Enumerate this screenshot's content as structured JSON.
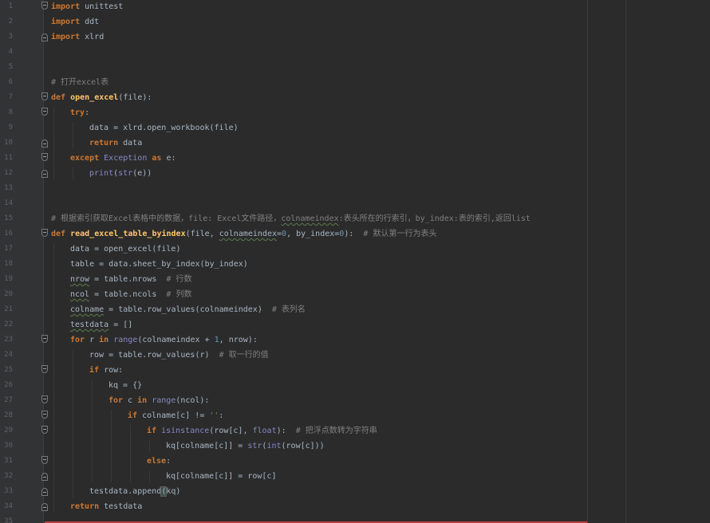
{
  "editor": {
    "language": "python",
    "colors": {
      "background": "#2b2b2b",
      "gutter": "#313335",
      "keyword": "#cc7832",
      "function": "#ffc66d",
      "builtin": "#8888c6",
      "comment": "#808080",
      "number": "#6897bb",
      "string": "#6a8759",
      "text": "#a9b7c6",
      "error_marker": "#bc3f3c"
    },
    "lines": [
      {
        "n": "1",
        "indent": 0,
        "fold": "open",
        "tokens": [
          [
            "kw",
            "import"
          ],
          [
            "t",
            " unittest"
          ]
        ]
      },
      {
        "n": "2",
        "indent": 0,
        "tokens": [
          [
            "kw",
            "import"
          ],
          [
            "t",
            " ddt"
          ]
        ]
      },
      {
        "n": "3",
        "indent": 0,
        "fold": "end",
        "tokens": [
          [
            "kw",
            "import"
          ],
          [
            "t",
            " xlrd"
          ]
        ]
      },
      {
        "n": "4",
        "indent": 0,
        "tokens": []
      },
      {
        "n": "5",
        "indent": 0,
        "tokens": []
      },
      {
        "n": "6",
        "indent": 0,
        "tokens": [
          [
            "cm",
            "# 打开excel表"
          ]
        ]
      },
      {
        "n": "7",
        "indent": 0,
        "fold": "open",
        "tokens": [
          [
            "kw",
            "def "
          ],
          [
            "fn",
            "open_excel"
          ],
          [
            "t",
            "(file):"
          ]
        ]
      },
      {
        "n": "8",
        "indent": 1,
        "fold": "open",
        "tokens": [
          [
            "kw",
            "try"
          ],
          [
            "t",
            ":"
          ]
        ]
      },
      {
        "n": "9",
        "indent": 2,
        "tokens": [
          [
            "t",
            "data = xlrd.open_workbook(file)"
          ]
        ]
      },
      {
        "n": "10",
        "indent": 2,
        "fold": "end",
        "tokens": [
          [
            "kw",
            "return"
          ],
          [
            "t",
            " data"
          ]
        ]
      },
      {
        "n": "11",
        "indent": 1,
        "fold": "open",
        "tokens": [
          [
            "kw",
            "except"
          ],
          [
            "t",
            " "
          ],
          [
            "bi",
            "Exception"
          ],
          [
            "t",
            " "
          ],
          [
            "kw",
            "as"
          ],
          [
            "t",
            " e:"
          ]
        ]
      },
      {
        "n": "12",
        "indent": 2,
        "fold": "end",
        "tokens": [
          [
            "bi",
            "print"
          ],
          [
            "t",
            "("
          ],
          [
            "bi",
            "str"
          ],
          [
            "t",
            "(e))"
          ]
        ]
      },
      {
        "n": "13",
        "indent": 0,
        "tokens": []
      },
      {
        "n": "14",
        "indent": 0,
        "tokens": []
      },
      {
        "n": "15",
        "indent": 0,
        "tokens": [
          [
            "cm",
            "# 根据索引获取Excel表格中的数据，file: Excel文件路径，"
          ],
          [
            "cmul",
            "colnameindex"
          ],
          [
            "cm",
            ":表头所在的行索引，by_index:表的索引,返回list"
          ]
        ]
      },
      {
        "n": "16",
        "indent": 0,
        "fold": "open",
        "tokens": [
          [
            "kw",
            "def "
          ],
          [
            "fn",
            "read_excel_table_byindex"
          ],
          [
            "t",
            "(file, "
          ],
          [
            "ul",
            "colnameindex"
          ],
          [
            "t",
            "="
          ],
          [
            "num",
            "0"
          ],
          [
            "t",
            ", by_index="
          ],
          [
            "num",
            "0"
          ],
          [
            "t",
            "):  "
          ],
          [
            "cm",
            "# 默认第一行为表头"
          ]
        ]
      },
      {
        "n": "17",
        "indent": 1,
        "tokens": [
          [
            "t",
            "data = open_excel(file)"
          ]
        ]
      },
      {
        "n": "18",
        "indent": 1,
        "tokens": [
          [
            "t",
            "table = data.sheet_by_index(by_index)"
          ]
        ]
      },
      {
        "n": "19",
        "indent": 1,
        "tokens": [
          [
            "ul",
            "nrow"
          ],
          [
            "t",
            " = table.nrows  "
          ],
          [
            "cm",
            "# 行数"
          ]
        ]
      },
      {
        "n": "20",
        "indent": 1,
        "tokens": [
          [
            "ul",
            "ncol"
          ],
          [
            "t",
            " = table.ncols  "
          ],
          [
            "cm",
            "# 列数"
          ]
        ]
      },
      {
        "n": "21",
        "indent": 1,
        "tokens": [
          [
            "ul",
            "colname"
          ],
          [
            "t",
            " = table.row_values(colnameindex)  "
          ],
          [
            "cm",
            "# 表列名"
          ]
        ]
      },
      {
        "n": "22",
        "indent": 1,
        "tokens": [
          [
            "ul",
            "testdata"
          ],
          [
            "t",
            " = []"
          ]
        ]
      },
      {
        "n": "23",
        "indent": 1,
        "fold": "open",
        "tokens": [
          [
            "kw",
            "for"
          ],
          [
            "t",
            " r "
          ],
          [
            "kw",
            "in"
          ],
          [
            "t",
            " "
          ],
          [
            "bi",
            "range"
          ],
          [
            "t",
            "(colnameindex + "
          ],
          [
            "num",
            "1"
          ],
          [
            "t",
            ", nrow):"
          ]
        ]
      },
      {
        "n": "24",
        "indent": 2,
        "tokens": [
          [
            "t",
            "row = table.row_values(r)  "
          ],
          [
            "cm",
            "# 取一行的值"
          ]
        ]
      },
      {
        "n": "25",
        "indent": 2,
        "fold": "open",
        "tokens": [
          [
            "kw",
            "if"
          ],
          [
            "t",
            " row:"
          ]
        ]
      },
      {
        "n": "26",
        "indent": 3,
        "tokens": [
          [
            "t",
            "kq = {}"
          ]
        ]
      },
      {
        "n": "27",
        "indent": 3,
        "fold": "open",
        "tokens": [
          [
            "kw",
            "for"
          ],
          [
            "t",
            " c "
          ],
          [
            "kw",
            "in"
          ],
          [
            "t",
            " "
          ],
          [
            "bi",
            "range"
          ],
          [
            "t",
            "(ncol):"
          ]
        ]
      },
      {
        "n": "28",
        "indent": 4,
        "fold": "open",
        "tokens": [
          [
            "kw",
            "if"
          ],
          [
            "t",
            " colname[c] != "
          ],
          [
            "str",
            "''"
          ],
          [
            "t",
            ":"
          ]
        ]
      },
      {
        "n": "29",
        "indent": 5,
        "fold": "open",
        "tokens": [
          [
            "kw",
            "if"
          ],
          [
            "t",
            " "
          ],
          [
            "bi",
            "isinstance"
          ],
          [
            "t",
            "(row[c], "
          ],
          [
            "bi",
            "float"
          ],
          [
            "t",
            "):  "
          ],
          [
            "cm",
            "# 把浮点数转为字符串"
          ]
        ]
      },
      {
        "n": "30",
        "indent": 6,
        "tokens": [
          [
            "t",
            "kq[colname[c]] = "
          ],
          [
            "bi",
            "str"
          ],
          [
            "t",
            "("
          ],
          [
            "bi",
            "int"
          ],
          [
            "t",
            "(row[c]))"
          ]
        ]
      },
      {
        "n": "31",
        "indent": 5,
        "fold": "open",
        "tokens": [
          [
            "kw",
            "else"
          ],
          [
            "t",
            ":"
          ]
        ]
      },
      {
        "n": "32",
        "indent": 6,
        "fold": "end",
        "tokens": [
          [
            "t",
            "kq[colname[c]] = row[c]"
          ]
        ]
      },
      {
        "n": "33",
        "indent": 2,
        "fold": "end",
        "tokens": [
          [
            "t",
            "testdata.append"
          ],
          [
            "br",
            "("
          ],
          [
            "t",
            "kq)"
          ]
        ]
      },
      {
        "n": "34",
        "indent": 1,
        "fold": "end",
        "tokens": [
          [
            "kw",
            "return"
          ],
          [
            "t",
            " testdata"
          ]
        ]
      },
      {
        "n": "35",
        "indent": 0,
        "tokens": []
      }
    ]
  }
}
